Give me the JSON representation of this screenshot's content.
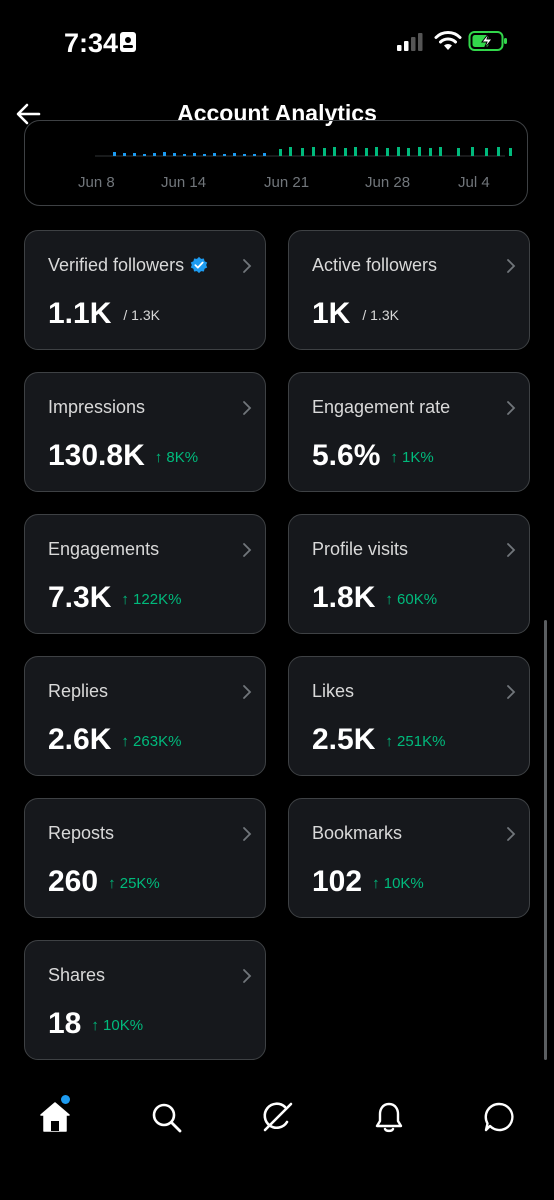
{
  "status_bar": {
    "time": "7:34"
  },
  "header": {
    "title": "Account Analytics"
  },
  "chart": {
    "x_ticks": [
      "Jun 8",
      "Jun 14",
      "Jun 21",
      "Jun 28",
      "Jul 4"
    ]
  },
  "cards": [
    {
      "label": "Verified followers",
      "value": "1.1K",
      "total": "/ 1.3K",
      "verified_badge": true
    },
    {
      "label": "Active followers",
      "value": "1K",
      "total": "/ 1.3K"
    },
    {
      "label": "Impressions",
      "value": "130.8K",
      "delta": "↑ 8K%"
    },
    {
      "label": "Engagement rate",
      "value": "5.6%",
      "delta": "↑ 1K%"
    },
    {
      "label": "Engagements",
      "value": "7.3K",
      "delta": "↑ 122K%"
    },
    {
      "label": "Profile visits",
      "value": "1.8K",
      "delta": "↑ 60K%"
    },
    {
      "label": "Replies",
      "value": "2.6K",
      "delta": "↑ 263K%"
    },
    {
      "label": "Likes",
      "value": "2.5K",
      "delta": "↑ 251K%"
    },
    {
      "label": "Reposts",
      "value": "260",
      "delta": "↑ 25K%"
    },
    {
      "label": "Bookmarks",
      "value": "102",
      "delta": "↑ 10K%"
    },
    {
      "label": "Shares",
      "value": "18",
      "delta": "↑ 10K%"
    }
  ],
  "tabbar": {
    "items": [
      "home-icon",
      "search-icon",
      "grok-icon",
      "notifications-icon",
      "messages-icon"
    ]
  },
  "colors": {
    "positive": "#00ba7c",
    "accent": "#1d9bf0",
    "card_bg": "#16181c",
    "border": "#3e4144"
  }
}
